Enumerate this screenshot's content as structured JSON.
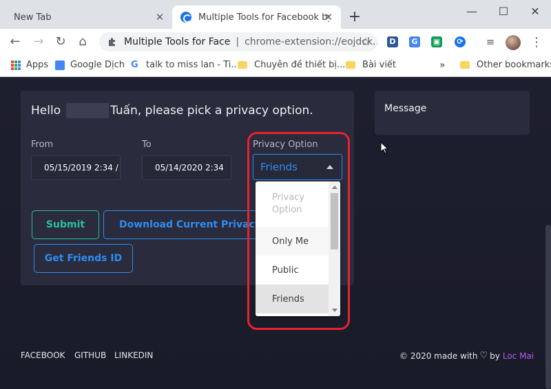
{
  "browser": {
    "tabs": [
      {
        "label": "New Tab"
      },
      {
        "label": "Multiple Tools for Facebook by Lo"
      }
    ],
    "new_tab_label": "+",
    "window_controls": {
      "minimize": "—",
      "maximize": "☐",
      "close": "✕"
    },
    "omnibox": {
      "site_name": "Multiple Tools for Face",
      "separator": "|",
      "url": "chrome-extension://eojdck..."
    },
    "extensions": [
      {
        "label": "D",
        "color": "#2b5797"
      },
      {
        "label": "G",
        "color": "#4285f4"
      },
      {
        "label": "▣",
        "color": "#0f9d58"
      },
      {
        "label": "⟳",
        "color": "#1a73e8"
      }
    ],
    "bookmarks": [
      {
        "label": "Apps"
      },
      {
        "label": "Google Dịch"
      },
      {
        "label": "talk to miss lan - Ti..."
      },
      {
        "label": "Chuyên đề thiết bị..."
      },
      {
        "label": "Bài viết"
      }
    ],
    "bookmarks_more": "»",
    "other_bookmarks": "Other bookmarks"
  },
  "form": {
    "greeting_prefix": "Hello",
    "greeting_suffix": "Tuấn, please pick a privacy option.",
    "from_label": "From",
    "from_value": "05/15/2019 2:34 /",
    "to_label": "To",
    "to_value": "05/14/2020 2:34",
    "privacy_label": "Privacy Option",
    "privacy_selected": "Friends",
    "privacy_options": [
      "Privacy Option",
      "Only Me",
      "Public",
      "Friends"
    ],
    "submit_label": "Submit",
    "download_label": "Download Current Privacy",
    "friends_id_label": "Get Friends ID"
  },
  "message_panel": {
    "title": "Message"
  },
  "footer": {
    "links": [
      "FACEBOOK",
      "GITHUB",
      "LINKEDIN"
    ],
    "credit_prefix": "© 2020 made with",
    "credit_by": "by",
    "author": "Loc Mai"
  },
  "colors": {
    "accent_blue": "#2e8ef0",
    "accent_green": "#27c2a0",
    "highlight_red": "#e8222e",
    "author_purple": "#b65cf0"
  }
}
